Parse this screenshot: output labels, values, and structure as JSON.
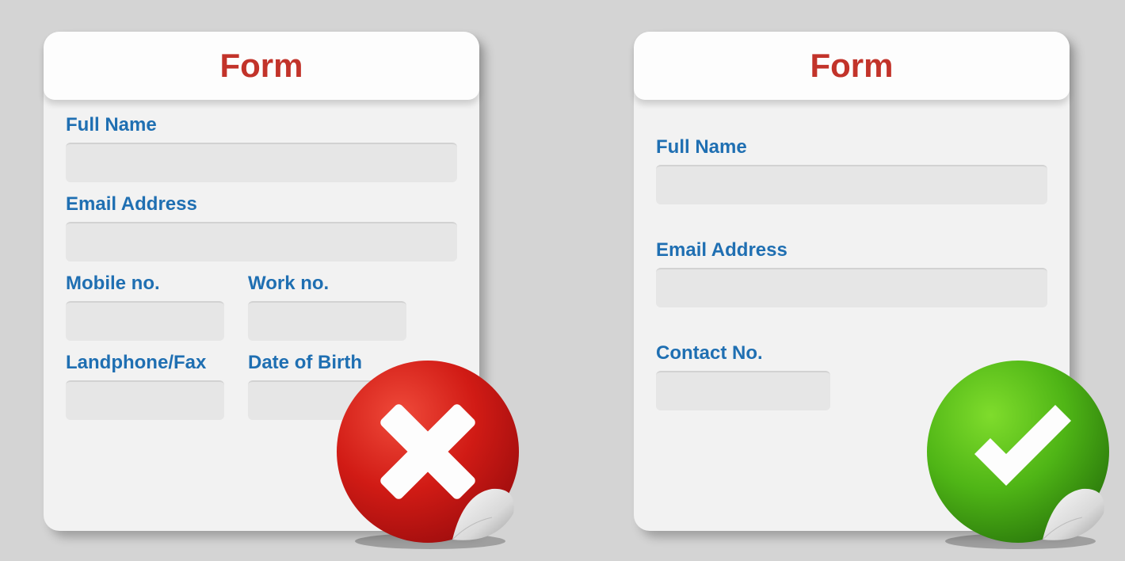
{
  "badForm": {
    "title": "Form",
    "fields": {
      "fullName": {
        "label": "Full Name"
      },
      "email": {
        "label": "Email Address"
      },
      "mobile": {
        "label": "Mobile no."
      },
      "work": {
        "label": "Work no."
      },
      "landphone": {
        "label": "Landphone/Fax"
      },
      "dob": {
        "label": "Date of Birth"
      }
    },
    "verdict": "incorrect"
  },
  "goodForm": {
    "title": "Form",
    "fields": {
      "fullName": {
        "label": "Full Name"
      },
      "email": {
        "label": "Email Address"
      },
      "contact": {
        "label": "Contact No."
      }
    },
    "verdict": "correct"
  },
  "colors": {
    "headerText": "#c2332a",
    "labelText": "#1f6fb2",
    "badBadge": "#d11b15",
    "goodBadge": "#4fb516"
  }
}
